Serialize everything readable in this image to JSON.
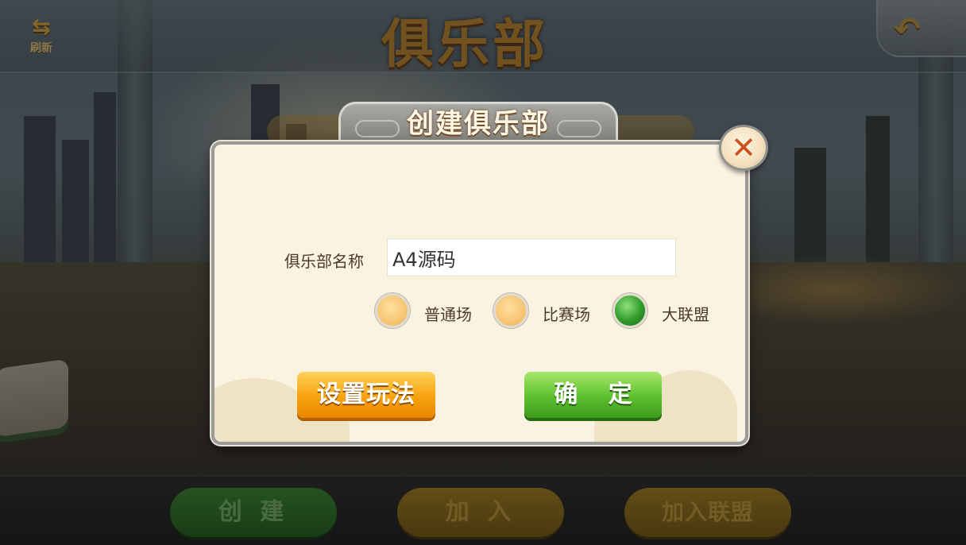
{
  "topbar": {
    "refresh_icon": "refresh-icon",
    "refresh_label": "刷新",
    "title": "俱乐部",
    "back_icon": "back-arrow-icon"
  },
  "modal": {
    "title": "创建俱乐部",
    "close_icon": "close-icon",
    "name_label": "俱乐部名称",
    "name_value": "A4源码",
    "mode_options": [
      {
        "label": "普通场",
        "selected": false
      },
      {
        "label": "比赛场",
        "selected": false
      },
      {
        "label": "大联盟",
        "selected": true
      }
    ],
    "setup_button": "设置玩法",
    "confirm_button": "确 定"
  },
  "bottombar": {
    "create_label": "创 建",
    "join_label": "加 入",
    "join_alliance_label": "加入联盟"
  },
  "colors": {
    "accent_orange": "#f7a20e",
    "accent_green": "#5cbf2e",
    "title_gold": "#c58a2e",
    "panel_bg": "#fbf3e1"
  }
}
